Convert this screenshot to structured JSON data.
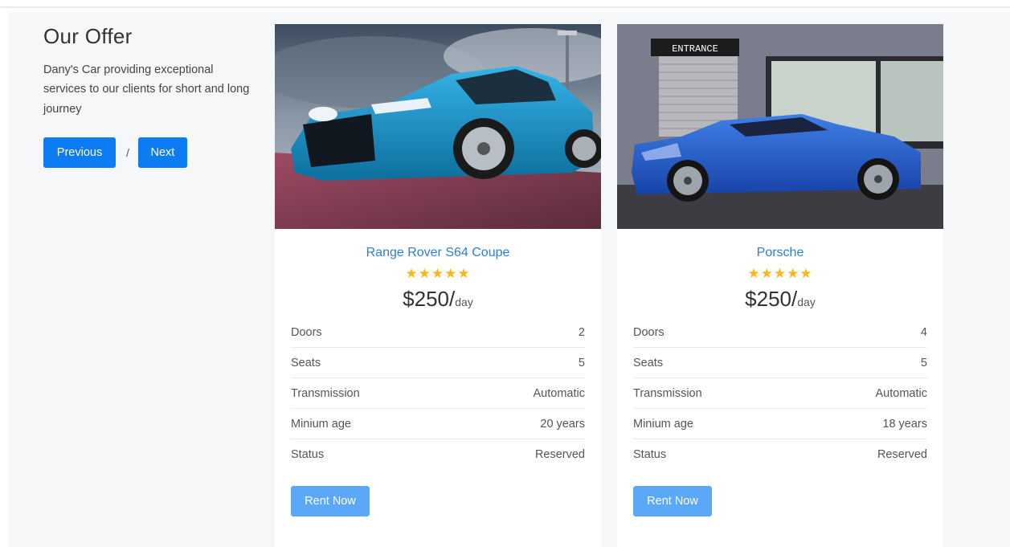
{
  "offer": {
    "title": "Our Offer",
    "description": "Dany's Car providing exceptional services to our clients for short and long journey",
    "previous_label": "Previous",
    "separator": "/",
    "next_label": "Next"
  },
  "cars": [
    {
      "name": "Range Rover S64 Coupe",
      "rating": 5,
      "stars": "★★★★★",
      "price": "$250/",
      "price_unit": "day",
      "image_icon": "blue-sports-sedan-photo",
      "specs": [
        {
          "label": "Doors",
          "value": "2"
        },
        {
          "label": "Seats",
          "value": "5"
        },
        {
          "label": "Transmission",
          "value": "Automatic"
        },
        {
          "label": "Minium age",
          "value": "20 years"
        },
        {
          "label": "Status",
          "value": "Reserved"
        }
      ],
      "button_label": "Rent Now"
    },
    {
      "name": "Porsche",
      "rating": 5,
      "stars": "★★★★★",
      "price": "$250/",
      "price_unit": "day",
      "image_icon": "blue-coupe-entrance-photo",
      "image_sign": "ENTRANCE",
      "specs": [
        {
          "label": "Doors",
          "value": "4"
        },
        {
          "label": "Seats",
          "value": "5"
        },
        {
          "label": "Transmission",
          "value": "Automatic"
        },
        {
          "label": "Minium age",
          "value": "18 years"
        },
        {
          "label": "Status",
          "value": "Reserved"
        }
      ],
      "button_label": "Rent Now"
    }
  ],
  "colors": {
    "primary": "#0d7cf2",
    "rent_button": "#5aa8f7",
    "car_name": "#2b7fd6",
    "star": "#f7b917",
    "section_bg": "#f6f7f9"
  }
}
